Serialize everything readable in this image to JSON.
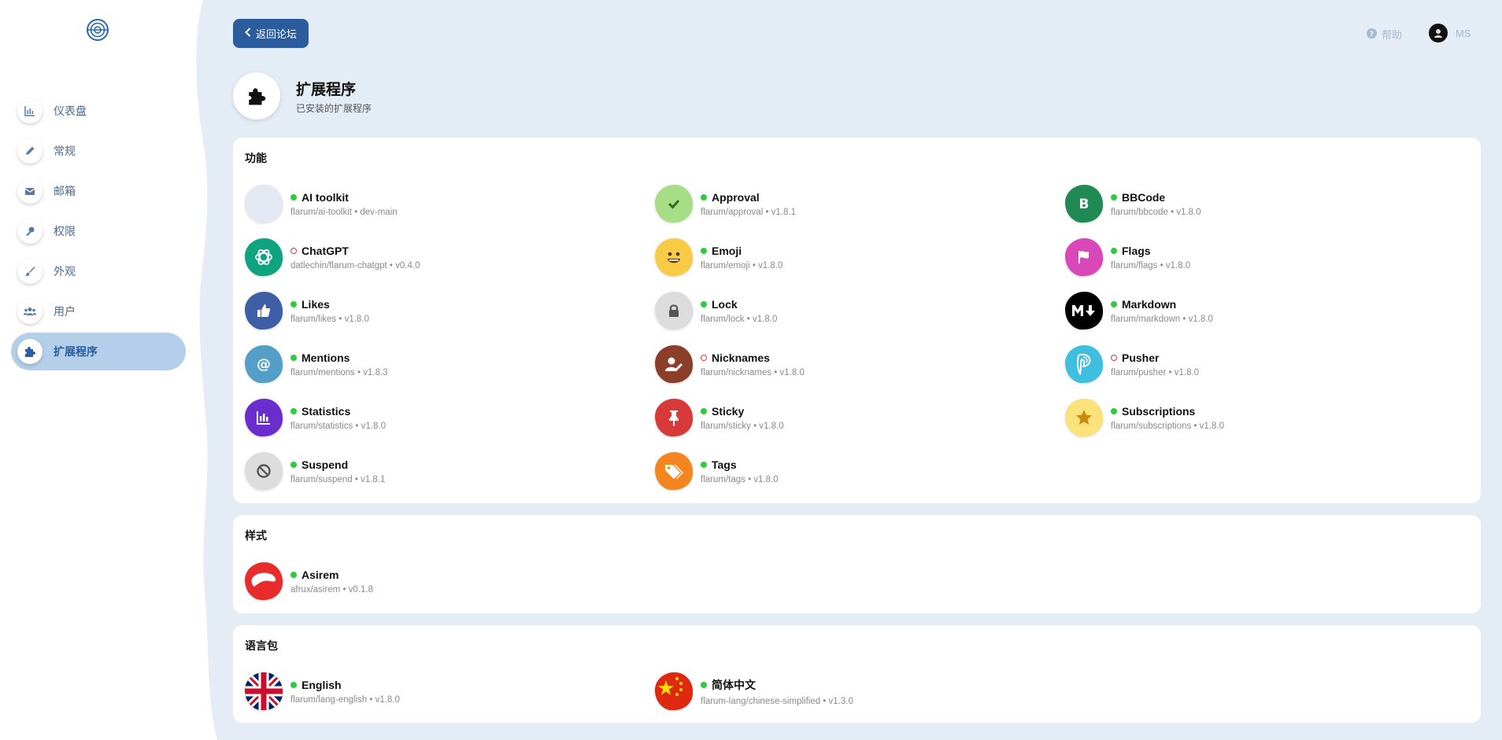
{
  "nav": {
    "items": [
      {
        "label": "仪表盘",
        "icon": "chart-icon"
      },
      {
        "label": "常规",
        "icon": "pencil-icon"
      },
      {
        "label": "邮箱",
        "icon": "envelope-icon"
      },
      {
        "label": "权限",
        "icon": "key-icon"
      },
      {
        "label": "外观",
        "icon": "paintbrush-icon"
      },
      {
        "label": "用户",
        "icon": "users-icon"
      },
      {
        "label": "扩展程序",
        "icon": "puzzle-icon",
        "active": true
      }
    ]
  },
  "header": {
    "back_label": "返回论坛",
    "help_label": "帮助",
    "user_name": "MS"
  },
  "page": {
    "title": "扩展程序",
    "subtitle": "已安装的扩展程序"
  },
  "sections": {
    "features": {
      "title": "功能",
      "items": [
        {
          "name": "AI toolkit",
          "meta": "flarum/ai-toolkit • dev-main",
          "enabled": true,
          "icon": "blank-icon",
          "color": "#e4e8f2"
        },
        {
          "name": "Approval",
          "meta": "flarum/approval • v1.8.1",
          "enabled": true,
          "icon": "check-icon",
          "color": "#a6dd86"
        },
        {
          "name": "BBCode",
          "meta": "flarum/bbcode • v1.8.0",
          "enabled": true,
          "icon": "bold-icon",
          "color": "#1f8a53"
        },
        {
          "name": "ChatGPT",
          "meta": "datlechin/flarum-chatgpt • v0.4.0",
          "enabled": false,
          "icon": "openai-icon",
          "color": "#10a37f"
        },
        {
          "name": "Emoji",
          "meta": "flarum/emoji • v1.8.0",
          "enabled": true,
          "icon": "smile-icon",
          "color": "#f8cb47"
        },
        {
          "name": "Flags",
          "meta": "flarum/flags • v1.8.0",
          "enabled": true,
          "icon": "flag-icon",
          "color": "#d848b8"
        },
        {
          "name": "Likes",
          "meta": "flarum/likes • v1.8.0",
          "enabled": true,
          "icon": "thumbs-up-icon",
          "color": "#3e5ea6"
        },
        {
          "name": "Lock",
          "meta": "flarum/lock • v1.8.0",
          "enabled": true,
          "icon": "lock-icon",
          "color": "#dcdcdc"
        },
        {
          "name": "Markdown",
          "meta": "flarum/markdown • v1.8.0",
          "enabled": true,
          "icon": "markdown-icon",
          "color": "#000000"
        },
        {
          "name": "Mentions",
          "meta": "flarum/mentions • v1.8.3",
          "enabled": true,
          "icon": "at-icon",
          "color": "#549fc8"
        },
        {
          "name": "Nicknames",
          "meta": "flarum/nicknames • v1.8.0",
          "enabled": false,
          "icon": "user-edit-icon",
          "color": "#8b3f28"
        },
        {
          "name": "Pusher",
          "meta": "flarum/pusher • v1.8.0",
          "enabled": false,
          "icon": "pusher-icon",
          "color": "#3fbfe0"
        },
        {
          "name": "Statistics",
          "meta": "flarum/statistics • v1.8.0",
          "enabled": true,
          "icon": "bar-chart-icon",
          "color": "#6a2ecf"
        },
        {
          "name": "Sticky",
          "meta": "flarum/sticky • v1.8.0",
          "enabled": true,
          "icon": "thumbtack-icon",
          "color": "#d83a3a"
        },
        {
          "name": "Subscriptions",
          "meta": "flarum/subscriptions • v1.8.0",
          "enabled": true,
          "icon": "star-icon",
          "color": "#fbe27a"
        },
        {
          "name": "Suspend",
          "meta": "flarum/suspend • v1.8.1",
          "enabled": true,
          "icon": "ban-icon",
          "color": "#dddddd"
        },
        {
          "name": "Tags",
          "meta": "flarum/tags • v1.8.0",
          "enabled": true,
          "icon": "tags-icon",
          "color": "#f5851f"
        }
      ]
    },
    "themes": {
      "title": "样式",
      "items": [
        {
          "name": "Asirem",
          "meta": "afrux/asirem • v0.1.8",
          "enabled": true,
          "icon": "asirem-icon",
          "color": "#e82c2c"
        }
      ]
    },
    "languages": {
      "title": "语言包",
      "items": [
        {
          "name": "English",
          "meta": "flarum/lang-english • v1.8.0",
          "enabled": true,
          "icon": "uk-flag-icon",
          "color": "#012169"
        },
        {
          "name": "简体中文",
          "meta": "flarum-lang/chinese-simplified • v1.3.0",
          "enabled": true,
          "icon": "china-flag-icon",
          "color": "#de2910"
        }
      ]
    }
  }
}
